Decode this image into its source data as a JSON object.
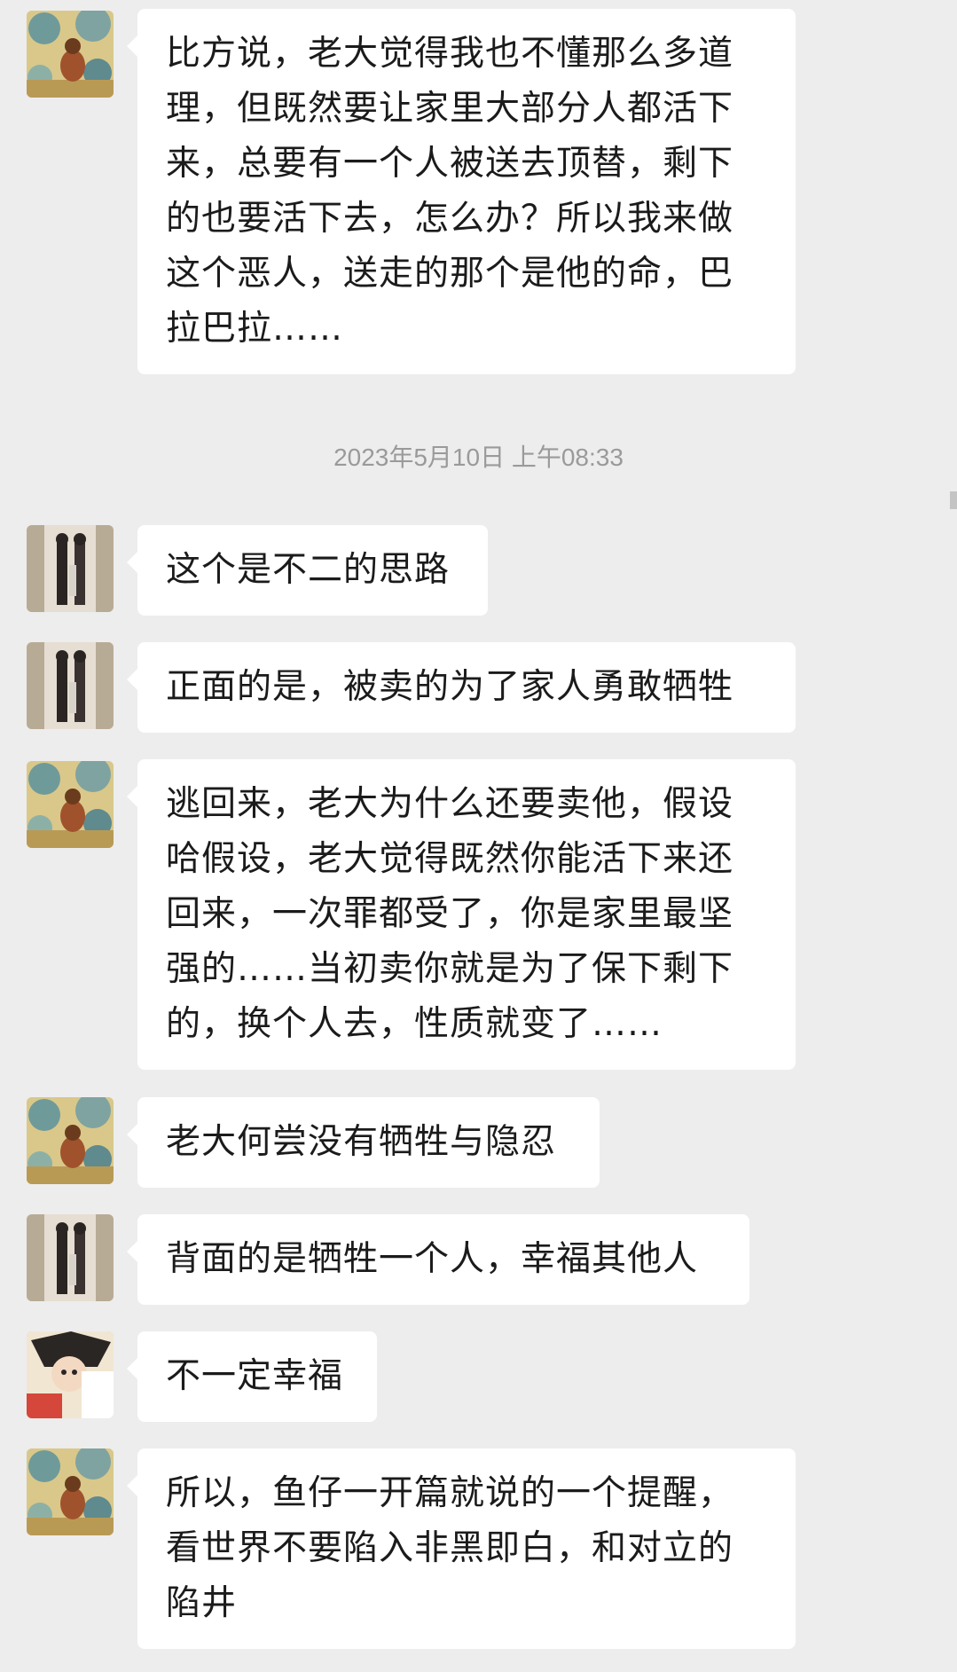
{
  "timestamp": "2023年5月10日 上午08:33",
  "messages": [
    {
      "avatar": "avatar-a",
      "text": "比方说，老大觉得我也不懂那么多道\n理，但既然要让家里大部分人都活下\n来，总要有一个人被送去顶替，剩下\n的也要活下去，怎么办？所以我来做\n这个恶人，送走的那个是他的命，巴\n拉巴拉……"
    },
    {
      "avatar": "avatar-b",
      "text": "这个是不二的思路"
    },
    {
      "avatar": "avatar-b",
      "text": "正面的是，被卖的为了家人勇敢牺牲"
    },
    {
      "avatar": "avatar-a",
      "text": "逃回来，老大为什么还要卖他，假设\n哈假设，老大觉得既然你能活下来还\n回来，一次罪都受了，你是家里最坚\n强的……当初卖你就是为了保下剩下\n的，换个人去，性质就变了……"
    },
    {
      "avatar": "avatar-a",
      "text": "老大何尝没有牺牲与隐忍"
    },
    {
      "avatar": "avatar-b",
      "text": "背面的是牺牲一个人，幸福其他人"
    },
    {
      "avatar": "avatar-c",
      "text": "不一定幸福"
    },
    {
      "avatar": "avatar-a",
      "text": "所以，鱼仔一开篇就说的一个提醒，\n看世界不要陷入非黑即白，和对立的\n陷井"
    }
  ]
}
